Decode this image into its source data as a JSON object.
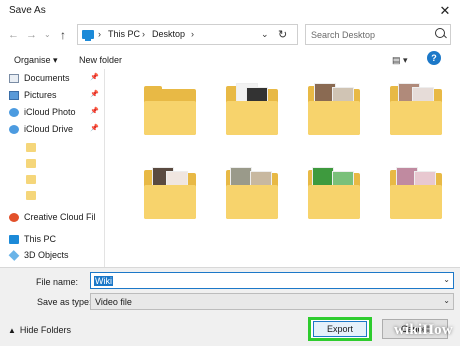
{
  "window": {
    "title": "Save As",
    "close_symbol": "✕"
  },
  "nav_buttons": {
    "back": "←",
    "forward": "→",
    "recent": "⌄",
    "up": "↑"
  },
  "address": {
    "separator": "›",
    "crumbs": [
      "This PC",
      "Desktop"
    ],
    "dropdown": "⌄",
    "refresh": "↻"
  },
  "search": {
    "placeholder": "Search Desktop"
  },
  "toolbar": {
    "organise": "Organise ▾",
    "new_folder": "New folder",
    "view": "▤ ▾",
    "help": "?"
  },
  "sidebar": {
    "items": [
      {
        "label": "Documents",
        "icon": "documents-icon",
        "pinned": true
      },
      {
        "label": "Pictures",
        "icon": "pictures-icon",
        "pinned": true
      },
      {
        "label": "iCloud Photo",
        "icon": "icloud-photos-icon",
        "pinned": true
      },
      {
        "label": "iCloud Drive",
        "icon": "icloud-drive-icon",
        "pinned": true
      },
      {
        "label": "Creative Cloud Fil",
        "icon": "creative-cloud-icon",
        "pinned": false
      },
      {
        "label": "This PC",
        "icon": "pc-icon",
        "pinned": false
      },
      {
        "label": "3D Objects",
        "icon": "3d-objects-icon",
        "pinned": false
      }
    ],
    "pin_symbol": "📌"
  },
  "folders": [
    {
      "icon": "folder-icon",
      "has_photos": false
    },
    {
      "icon": "folder-icon",
      "has_photos": true,
      "photo_colors": [
        "#333333",
        "#f2f2f2"
      ]
    },
    {
      "icon": "folder-icon",
      "has_photos": true,
      "photo_colors": [
        "#8a6a52",
        "#d0c4b4"
      ]
    },
    {
      "icon": "folder-icon",
      "has_photos": true,
      "photo_colors": [
        "#b08a7a",
        "#e6dcd8"
      ]
    },
    {
      "icon": "folder-icon",
      "has_photos": true,
      "photo_colors": [
        "#5a4a40",
        "#f0e6e0"
      ]
    },
    {
      "icon": "folder-icon",
      "has_photos": true,
      "photo_colors": [
        "#9a9a8a",
        "#c8b8a0"
      ]
    },
    {
      "icon": "folder-icon",
      "has_photos": true,
      "photo_colors": [
        "#3e9a3e",
        "#7ac07a"
      ]
    },
    {
      "icon": "folder-icon",
      "has_photos": true,
      "photo_colors": [
        "#c08aa0",
        "#e8c8d0"
      ]
    }
  ],
  "form": {
    "filename_label": "File name:",
    "filename_value": "Wiki",
    "savetype_label": "Save as type:",
    "savetype_value": "Video file",
    "dropdown_symbol": "⌄"
  },
  "footer": {
    "hide_folders": "Hide Folders",
    "hide_arrow": "▲",
    "export": "Export",
    "cancel": "Cancel"
  },
  "watermark": "wikiHow",
  "colors": {
    "accent": "#1c78c8",
    "export_highlight": "#2ecc2e",
    "folder": "#f7d36c"
  }
}
